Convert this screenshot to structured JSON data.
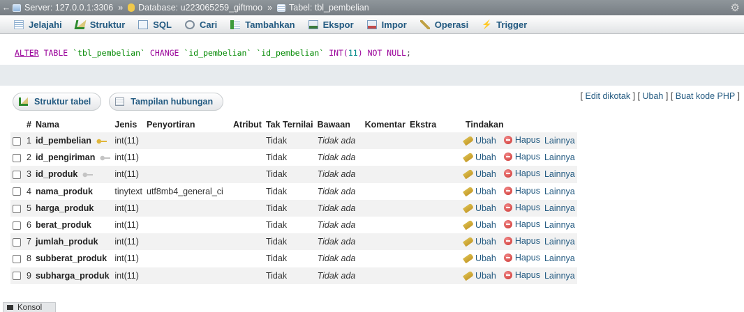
{
  "breadcrumb": {
    "server": "Server: 127.0.0.1:3306",
    "database": "Database: u223065259_giftmoo",
    "table": "Tabel: tbl_pembelian",
    "separator": "»"
  },
  "tabs": [
    {
      "label": "Jelajahi",
      "icon": "browse-icon"
    },
    {
      "label": "Struktur",
      "icon": "structure-icon"
    },
    {
      "label": "SQL",
      "icon": "sql-icon"
    },
    {
      "label": "Cari",
      "icon": "search-icon"
    },
    {
      "label": "Tambahkan",
      "icon": "insert-icon"
    },
    {
      "label": "Ekspor",
      "icon": "export-icon"
    },
    {
      "label": "Impor",
      "icon": "import-icon"
    },
    {
      "label": "Operasi",
      "icon": "operations-icon"
    },
    {
      "label": "Trigger",
      "icon": "trigger-icon"
    }
  ],
  "sql": {
    "alter": "ALTER",
    "table_kw": "TABLE",
    "table_name": "`tbl_pembelian`",
    "change": "CHANGE",
    "col_old": "`id_pembelian`",
    "col_new": "`id_pembelian`",
    "type": "INT(",
    "size": "11",
    "type_close": ")",
    "not_null": "NOT NULL",
    "end": ";"
  },
  "edit_links": {
    "edit_inline": "Edit dikotak",
    "edit": "Ubah",
    "php": "Buat kode PHP"
  },
  "subtabs": {
    "structure": "Struktur tabel",
    "relations": "Tampilan hubungan"
  },
  "table": {
    "headers": [
      "#",
      "Nama",
      "Jenis",
      "Penyortiran",
      "Atribut",
      "Tak Ternilai",
      "Bawaan",
      "Komentar",
      "Ekstra",
      "Tindakan"
    ],
    "rows": [
      {
        "num": "1",
        "name": "id_pembelian",
        "key": "primary",
        "type": "int(11)",
        "collation": "",
        "null": "Tidak",
        "default": "Tidak ada"
      },
      {
        "num": "2",
        "name": "id_pengiriman",
        "key": "index",
        "type": "int(11)",
        "collation": "",
        "null": "Tidak",
        "default": "Tidak ada"
      },
      {
        "num": "3",
        "name": "id_produk",
        "key": "index",
        "type": "int(11)",
        "collation": "",
        "null": "Tidak",
        "default": "Tidak ada"
      },
      {
        "num": "4",
        "name": "nama_produk",
        "key": "",
        "type": "tinytext",
        "collation": "utf8mb4_general_ci",
        "null": "Tidak",
        "default": "Tidak ada"
      },
      {
        "num": "5",
        "name": "harga_produk",
        "key": "",
        "type": "int(11)",
        "collation": "",
        "null": "Tidak",
        "default": "Tidak ada"
      },
      {
        "num": "6",
        "name": "berat_produk",
        "key": "",
        "type": "int(11)",
        "collation": "",
        "null": "Tidak",
        "default": "Tidak ada"
      },
      {
        "num": "7",
        "name": "jumlah_produk",
        "key": "",
        "type": "int(11)",
        "collation": "",
        "null": "Tidak",
        "default": "Tidak ada"
      },
      {
        "num": "8",
        "name": "subberat_produk",
        "key": "",
        "type": "int(11)",
        "collation": "",
        "null": "Tidak",
        "default": "Tidak ada"
      },
      {
        "num": "9",
        "name": "subharga_produk",
        "key": "",
        "type": "int(11)",
        "collation": "",
        "null": "Tidak",
        "default": "Tidak ada"
      }
    ],
    "actions": {
      "edit": "Ubah",
      "delete": "Hapus",
      "more": "Lainnya"
    }
  },
  "console": {
    "label": "Konsol"
  },
  "colors": {
    "link": "#235a81",
    "row_alt": "#f2f2f2",
    "topbar": "#80878d"
  }
}
